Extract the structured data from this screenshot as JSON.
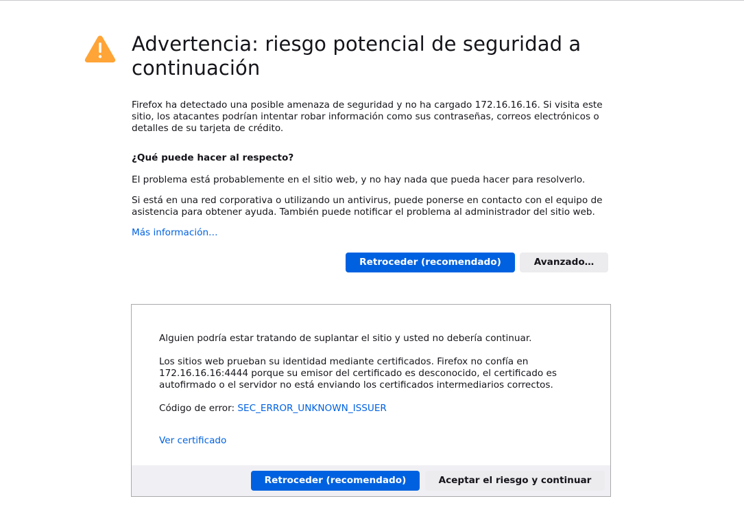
{
  "page": {
    "title": "Advertencia: riesgo potencial de seguridad a continuación",
    "intro": "Firefox ha detectado una posible amenaza de seguridad y no ha cargado 172.16.16.16. Si visita este sitio, los atacantes podrían intentar robar información como sus contraseñas, correos electrónicos o detalles de su tarjeta de crédito.",
    "what_heading": "¿Qué puede hacer al respecto?",
    "what_p1": "El problema está probablemente en el sitio web, y no hay nada que pueda hacer para resolverlo.",
    "what_p2": "Si está en una red corporativa o utilizando un antivirus, puede ponerse en contacto con el equipo de asistencia para obtener ayuda. También puede notificar el problema al administrador del sitio web.",
    "more_info": "Más información…"
  },
  "buttons": {
    "go_back": "Retroceder (recomendado)",
    "advanced": "Avanzado…",
    "accept_risk": "Aceptar el riesgo y continuar"
  },
  "advanced": {
    "line1": "Alguien podría estar tratando de suplantar el sitio y usted no debería continuar.",
    "line2": "Los sitios web prueban su identidad mediante certificados. Firefox no confía en 172.16.16.16:4444 porque su emisor del certificado es desconocido, el certificado es autofirmado o el servidor no está enviando los certificados intermediarios correctos.",
    "error_label": "Código de error: ",
    "error_code": "SEC_ERROR_UNKNOWN_ISSUER",
    "view_certificate": "Ver certificado"
  },
  "colors": {
    "accent": "#0061e0",
    "warning": "#ffa436",
    "secondary_button": "#ececee",
    "footer": "#f0f0f4"
  },
  "icons": {
    "warning": "warning-triangle-icon"
  }
}
